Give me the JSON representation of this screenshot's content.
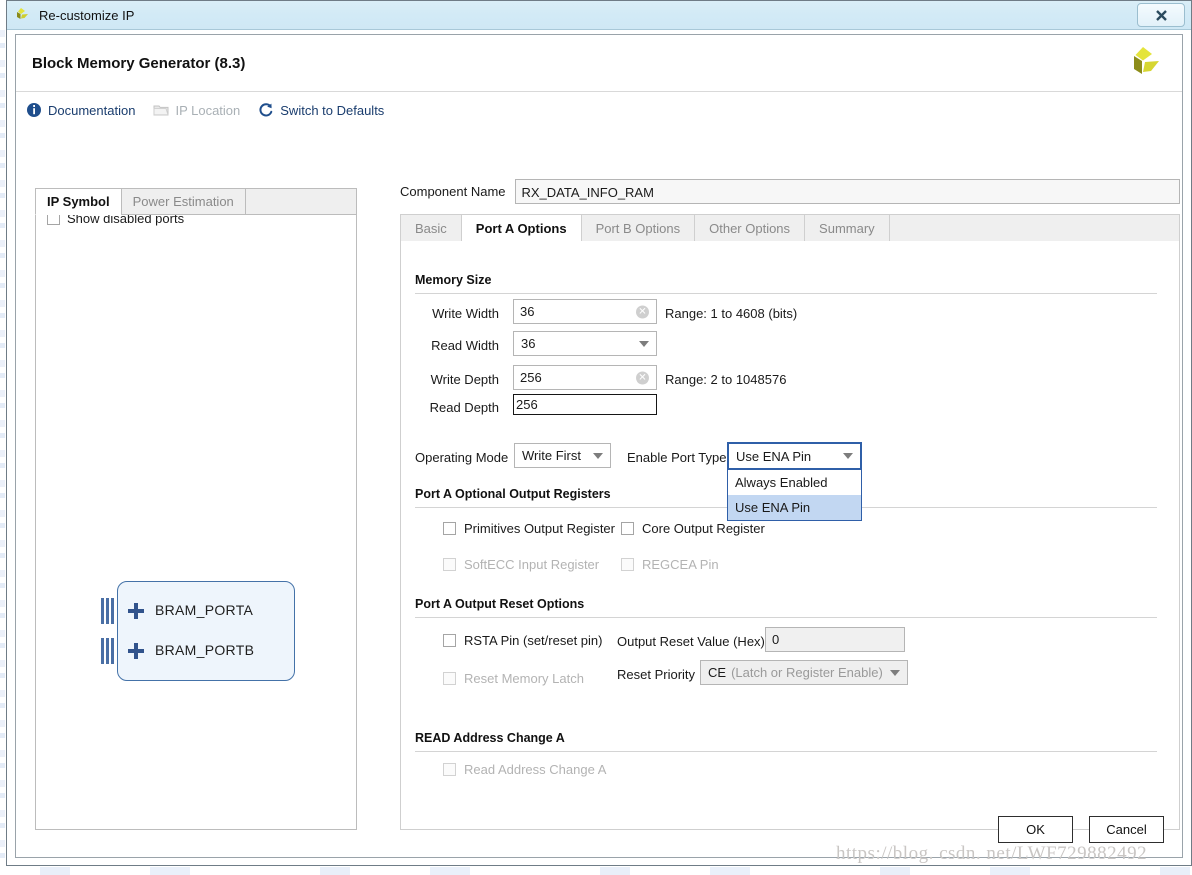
{
  "window": {
    "title": "Re-customize IP",
    "close_label": "✖",
    "app_icon": "xilinx-logo-icon"
  },
  "header": {
    "ip_title": "Block Memory Generator (8.3)",
    "logo_icon": "xilinx-logo-icon"
  },
  "toolbar": {
    "items": [
      {
        "label": "Documentation",
        "icon": "info-icon",
        "disabled": false
      },
      {
        "label": "IP Location",
        "icon": "folder-icon",
        "disabled": true
      },
      {
        "label": "Switch to Defaults",
        "icon": "refresh-icon",
        "disabled": false
      }
    ]
  },
  "left_pane": {
    "tabs": [
      {
        "label": "IP Symbol",
        "active": true
      },
      {
        "label": "Power Estimation",
        "active": false
      }
    ],
    "show_disabled_ports": {
      "label": "Show disabled ports",
      "checked": false
    },
    "symbol": {
      "ports": [
        {
          "label": "BRAM_PORTA",
          "expand_icon": "plus-icon"
        },
        {
          "label": "BRAM_PORTB",
          "expand_icon": "plus-icon"
        }
      ]
    }
  },
  "right_pane": {
    "component_name": {
      "label": "Component Name",
      "value": "RX_DATA_INFO_RAM",
      "placeholder": ""
    },
    "tabs": [
      {
        "label": "Basic",
        "active": false
      },
      {
        "label": "Port A Options",
        "active": true
      },
      {
        "label": "Port B Options",
        "active": false
      },
      {
        "label": "Other Options",
        "active": false
      },
      {
        "label": "Summary",
        "active": false
      }
    ],
    "memory_size": {
      "heading": "Memory Size",
      "write_width": {
        "label": "Write Width",
        "value": "36",
        "range": "Range: 1 to 4608 (bits)"
      },
      "read_width": {
        "label": "Read Width",
        "value": "36"
      },
      "write_depth": {
        "label": "Write Depth",
        "value": "256",
        "range": "Range: 2 to 1048576"
      },
      "read_depth": {
        "label": "Read Depth",
        "value": "256"
      }
    },
    "operating_mode": {
      "label": "Operating Mode",
      "value": "Write First"
    },
    "enable_port_type": {
      "label": "Enable Port Type",
      "value": "Use ENA Pin",
      "options": [
        {
          "label": "Always Enabled",
          "selected": false
        },
        {
          "label": "Use ENA Pin",
          "selected": true
        }
      ]
    },
    "optional_output_registers": {
      "heading": "Port A Optional Output Registers",
      "checkboxes": [
        {
          "label": "Primitives Output Register",
          "checked": false,
          "disabled": false
        },
        {
          "label": "Core Output Register",
          "checked": false,
          "disabled": false
        },
        {
          "label": "SoftECC Input Register",
          "checked": false,
          "disabled": true
        },
        {
          "label": "REGCEA Pin",
          "checked": false,
          "disabled": true
        }
      ]
    },
    "output_reset_options": {
      "heading": "Port A Output Reset Options",
      "rsta_pin": {
        "label": "RSTA Pin (set/reset pin)",
        "checked": false,
        "disabled": false
      },
      "reset_memory_latch": {
        "label": "Reset Memory Latch",
        "checked": false,
        "disabled": true
      },
      "output_reset_value": {
        "label": "Output Reset Value (Hex)",
        "value": "0"
      },
      "reset_priority": {
        "label": "Reset Priority",
        "value": "CE",
        "value_sub": "(Latch or Register Enable)"
      }
    },
    "read_address_change": {
      "heading": "READ Address Change A",
      "checkbox": {
        "label": "Read Address Change A",
        "checked": false,
        "disabled": true
      }
    }
  },
  "footer": {
    "ok_label": "OK",
    "cancel_label": "Cancel"
  },
  "watermark": "https://blog. csdn. net/LWF729882492",
  "colors": {
    "titlebar": "#d2eaf6",
    "accent_blue": "#2f5fa8",
    "selection": "#c2d7f2",
    "link_text": "#1a3d6e",
    "disabled_text": "#b3b3b3",
    "symbol_fill": "#eef5fc",
    "symbol_border": "#4472a8",
    "logo_yellow": "#d8d830"
  }
}
